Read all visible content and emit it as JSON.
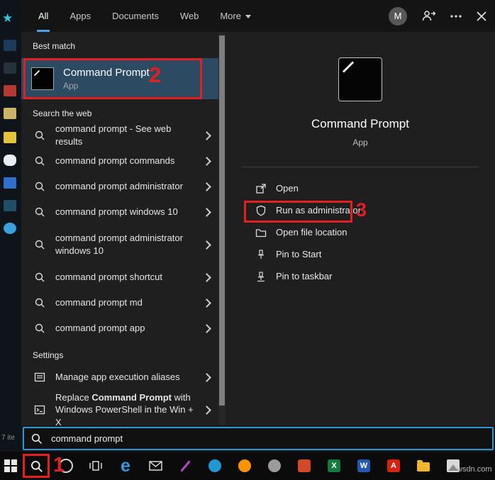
{
  "header": {
    "tabs": [
      {
        "label": "All"
      },
      {
        "label": "Apps"
      },
      {
        "label": "Documents"
      },
      {
        "label": "Web"
      },
      {
        "label": "More"
      }
    ],
    "active_tab": "All",
    "avatar_letter": "M"
  },
  "left": {
    "best_match_header": "Best match",
    "best_match": {
      "title": "Command Prompt",
      "subtitle": "App"
    },
    "web_header": "Search the web",
    "web_items": [
      {
        "label": "command prompt - See web results"
      },
      {
        "label": "command prompt commands"
      },
      {
        "label": "command prompt administrator"
      },
      {
        "label": "command prompt windows 10"
      },
      {
        "label": "command prompt administrator windows 10"
      },
      {
        "label": "command prompt shortcut"
      },
      {
        "label": "command prompt md"
      },
      {
        "label": "command prompt app"
      }
    ],
    "settings_header": "Settings",
    "settings_items": [
      {
        "label": "Manage app execution aliases"
      },
      {
        "label_prefix": "Replace ",
        "label_bold": "Command Prompt",
        "label_suffix": " with Windows PowerShell in the Win + X"
      }
    ]
  },
  "right": {
    "app_title": "Command Prompt",
    "app_subtitle": "App",
    "actions": [
      {
        "label": "Open"
      },
      {
        "label": "Run as administrator"
      },
      {
        "label": "Open file location"
      },
      {
        "label": "Pin to Start"
      },
      {
        "label": "Pin to taskbar"
      }
    ]
  },
  "search_bar": {
    "value": "command prompt"
  },
  "desktop": {
    "items_count": "7 ite"
  },
  "watermark": "wsdn.com",
  "annotations": {
    "step1": "1",
    "step2": "2",
    "step3": "3"
  },
  "taskbar": {
    "edge_letter": "e",
    "excel_letter": "X",
    "word_letter": "W",
    "acrobat_letter": "A"
  },
  "colors": {
    "accent": "#4ba0e8",
    "selection": "#2d4a63",
    "annotation": "#e41f1f",
    "search_border": "#2f96d8"
  }
}
